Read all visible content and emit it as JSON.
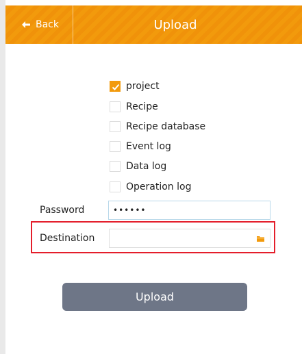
{
  "header": {
    "back_label": "Back",
    "title": "Upload",
    "color": "#f29a0c"
  },
  "options": [
    {
      "label": "project",
      "checked": true
    },
    {
      "label": "Recipe",
      "checked": false
    },
    {
      "label": "Recipe database",
      "checked": false
    },
    {
      "label": "Event log",
      "checked": false
    },
    {
      "label": "Data log",
      "checked": false
    },
    {
      "label": "Operation log",
      "checked": false
    }
  ],
  "password": {
    "label": "Password",
    "value": "••••••"
  },
  "destination": {
    "label": "Destination",
    "value": "",
    "icon": "folder-icon"
  },
  "upload_button": {
    "label": "Upload",
    "color": "#6e7687"
  },
  "highlight_color": "#e41e2b"
}
